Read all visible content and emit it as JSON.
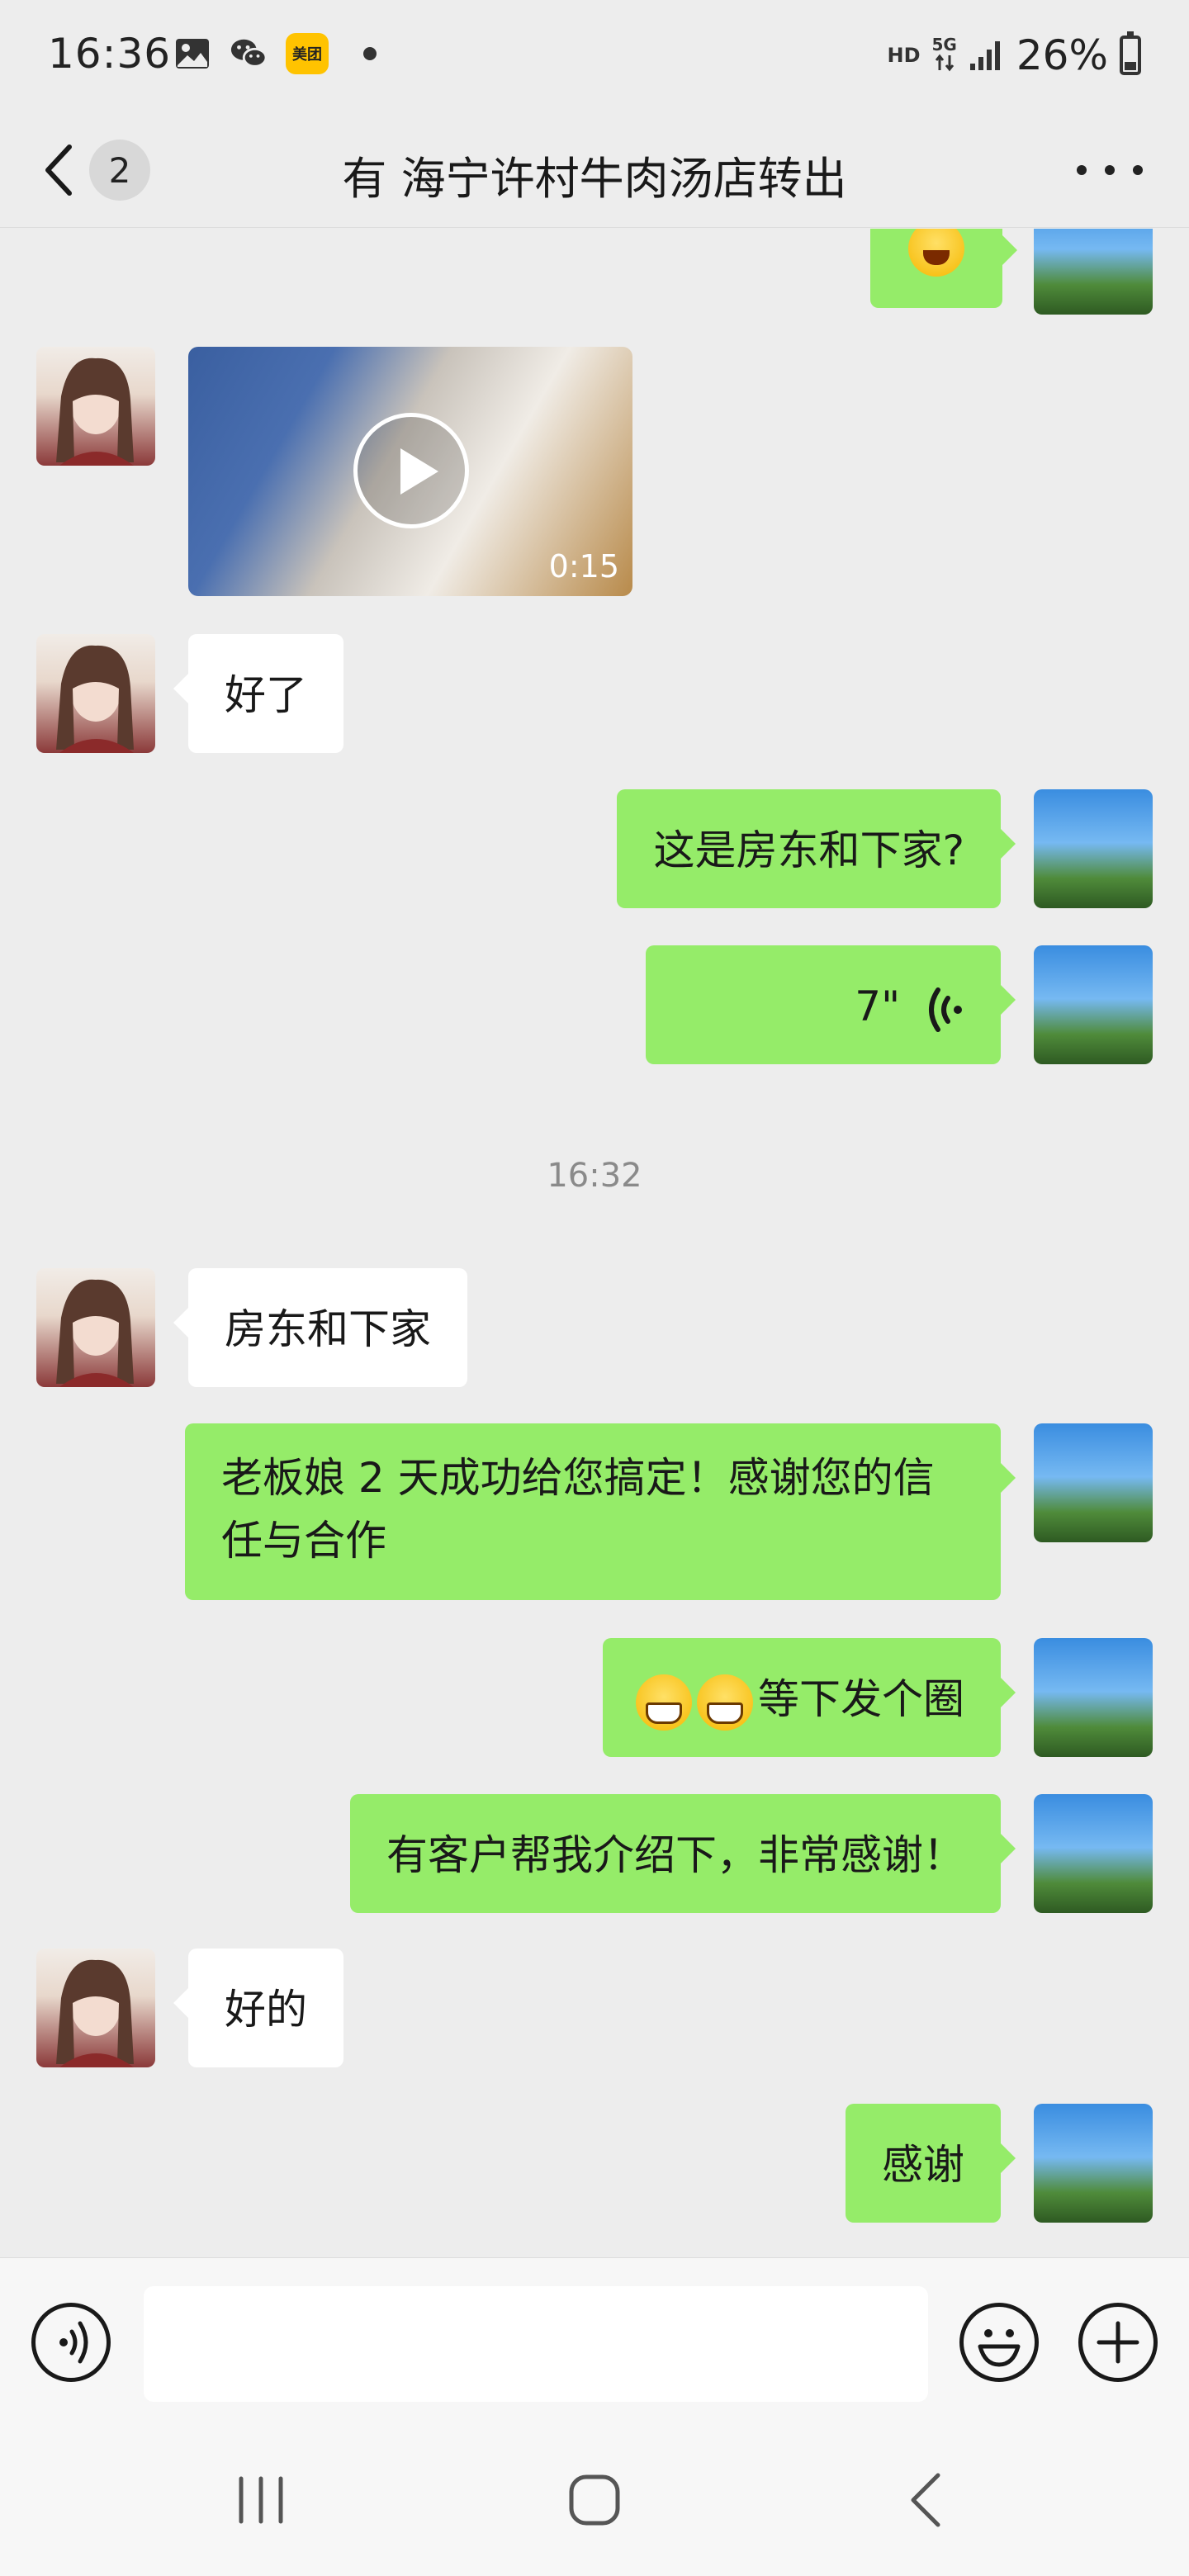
{
  "status_bar": {
    "time": "16:36",
    "meituan_label": "美团",
    "network_hd": "HD",
    "network_5g": "5G",
    "battery": "26%"
  },
  "nav": {
    "unread_count": "2",
    "title": "有 海宁许村牛肉汤店转出"
  },
  "messages": {
    "m1": {
      "side": "right",
      "type": "emoji",
      "emoji": "laugh-cry-emoji"
    },
    "m2": {
      "side": "left",
      "type": "video",
      "duration": "0:15"
    },
    "m3": {
      "side": "left",
      "text": "好了"
    },
    "m4": {
      "side": "right",
      "text": "这是房东和下家?"
    },
    "m5": {
      "side": "right",
      "type": "voice",
      "duration": "7\""
    },
    "time_separator": "16:32",
    "m6": {
      "side": "left",
      "text": "房东和下家"
    },
    "m7": {
      "side": "right",
      "text": "老板娘 2 天成功给您搞定！感谢您的信任与合作"
    },
    "m8": {
      "side": "right",
      "text": "等下发个圈",
      "emoji_prefix": [
        "grin-emoji",
        "grin-emoji"
      ]
    },
    "m9": {
      "side": "right",
      "text": "有客户帮我介绍下，非常感谢！"
    },
    "m10": {
      "side": "left",
      "text": "好的"
    },
    "m11": {
      "side": "right",
      "text": "感谢"
    }
  },
  "input_bar": {
    "placeholder": "",
    "icons": [
      "voice-icon",
      "emoji-icon",
      "plus-icon"
    ]
  },
  "colors": {
    "background": "#ededed",
    "bubble_mine": "#95ec69",
    "bubble_other": "#ffffff",
    "timestamp": "#8a8a8a"
  }
}
